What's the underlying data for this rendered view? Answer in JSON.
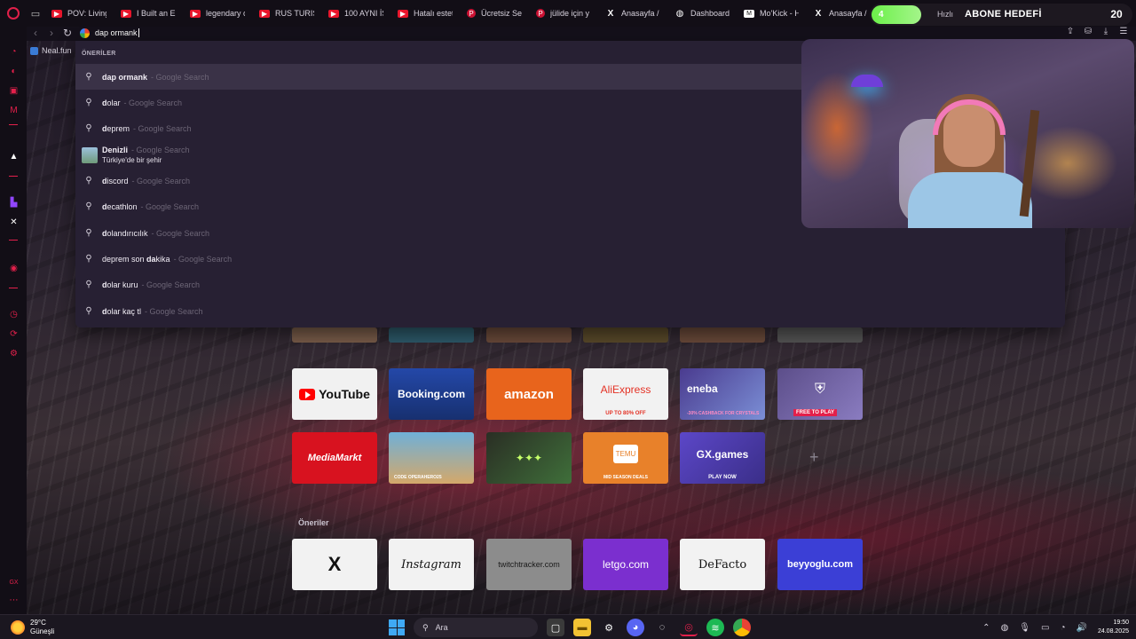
{
  "tabs": [
    {
      "label": "POV: Living",
      "icon": "youtube-icon"
    },
    {
      "label": "I Built an En",
      "icon": "youtube-icon"
    },
    {
      "label": "legendary c",
      "icon": "youtube-icon"
    },
    {
      "label": "RUS TURIS",
      "icon": "youtube-icon"
    },
    {
      "label": "100 AYNI İŞ",
      "icon": "youtube-icon"
    },
    {
      "label": "Hatalı estet",
      "icon": "youtube-icon"
    },
    {
      "label": "Ücretsiz Se",
      "icon": "pinterest-icon"
    },
    {
      "label": "jülide için y",
      "icon": "pinterest-icon"
    },
    {
      "label": "Anasayfa /",
      "icon": "x-icon"
    },
    {
      "label": "Dashboard",
      "icon": "dashboard-icon"
    },
    {
      "label": "Mo'Kick - H",
      "icon": "mokick-icon"
    },
    {
      "label": "Anasayfa /",
      "icon": "x-icon"
    }
  ],
  "overlay": {
    "goal_current": "4",
    "goal_title": "ABONE HEDEFİ",
    "goal_target": "20",
    "quick_label": "Hızlı"
  },
  "address_bar": {
    "query": "dap ormank"
  },
  "bookmarks": [
    {
      "label": "Neal.fun"
    }
  ],
  "autocomplete": {
    "header": "ÖNERİLER",
    "suggestions": [
      {
        "bold": "dap ormank",
        "rest": "",
        "source": "Google Search",
        "type": "search",
        "active": true
      },
      {
        "bold": "d",
        "rest": "olar",
        "source": "Google Search",
        "type": "search"
      },
      {
        "bold": "d",
        "rest": "eprem",
        "source": "Google Search",
        "type": "search"
      },
      {
        "bold": "Denizli",
        "rest": "",
        "source": "Google Search",
        "type": "entity",
        "subtitle": "Türkiye'de bir şehir"
      },
      {
        "bold": "d",
        "rest": "iscord",
        "source": "Google Search",
        "type": "search"
      },
      {
        "bold": "d",
        "rest": "ecathlon",
        "source": "Google Search",
        "type": "search"
      },
      {
        "bold": "d",
        "rest": "olandırıcılık",
        "source": "Google Search",
        "type": "search"
      },
      {
        "bold": "d",
        "rest": "eprem son dakika",
        "source": "Google Search",
        "type": "search",
        "mixed": [
          "deprem son ",
          "da",
          "kika"
        ]
      },
      {
        "bold": "d",
        "rest": "olar kuru",
        "source": "Google Search",
        "type": "search"
      },
      {
        "bold": "d",
        "rest": "olar kaç tl",
        "source": "Google Search",
        "type": "search"
      }
    ],
    "separator": "-"
  },
  "speed_dial": {
    "row2": [
      {
        "label": "YouTube",
        "color": "#f1f1f1"
      },
      {
        "label": "Booking.com",
        "color": "#2a4bb0"
      },
      {
        "label": "amazon",
        "color": "#e8641c"
      },
      {
        "label": "AliExpress",
        "sub": "UP TO 80% OFF",
        "color": "#f2f2f2"
      },
      {
        "label": "eneba",
        "sub": "-30% CASHBACK FOR CRYSTALS",
        "color": "#4a3b8f"
      },
      {
        "label": "",
        "sub": "FREE TO PLAY",
        "color": "#5c4e8a"
      }
    ],
    "row3": [
      {
        "label": "MediaMarkt",
        "color": "#d8121f"
      },
      {
        "label": "",
        "sub": "CODE OPERAHERO25",
        "color": "#d4a86a"
      },
      {
        "label": "",
        "color": "#2a2e24"
      },
      {
        "label": "TEMU",
        "sub": "MID SEASON DEALS",
        "color": "#e8812a"
      },
      {
        "label": "GX.games",
        "sub": "PLAY NOW",
        "color": "#5c47c8"
      }
    ],
    "suggestions_label": "Öneriler",
    "row4": [
      {
        "label": "X",
        "color": "#f2f2f2"
      },
      {
        "label": "Instagram",
        "color": "#f2f2f2"
      },
      {
        "label": "twitchtracker.com",
        "color": "#8c8c8c"
      },
      {
        "label": "letgo.com",
        "color": "#7b2fcf"
      },
      {
        "label": "DeFacto",
        "color": "#f2f2f2"
      },
      {
        "label": "beyyoglu.com",
        "color": "#3b3fd6"
      }
    ]
  },
  "taskbar": {
    "temp": "29°C",
    "weather": "Güneşli",
    "search_placeholder": "Ara",
    "time": "19:50",
    "date": "24.08.2025"
  }
}
